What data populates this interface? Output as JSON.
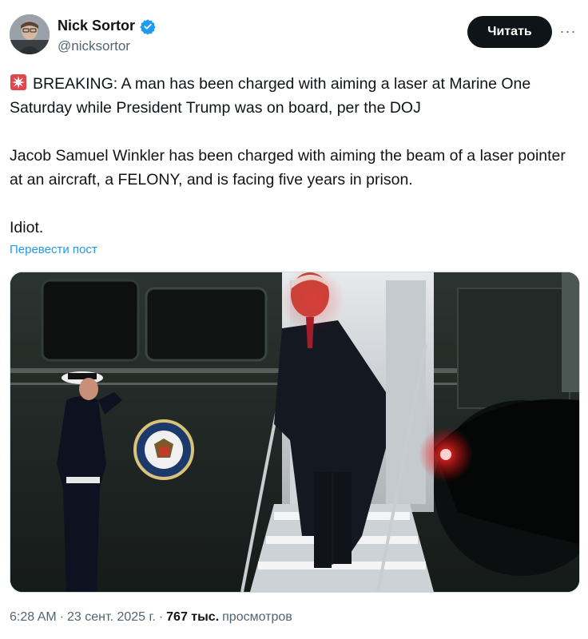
{
  "author": {
    "name": "Nick Sortor",
    "handle": "@nicksortor"
  },
  "header": {
    "read_button": "Читать",
    "more_label": "···"
  },
  "tweet": {
    "line1": "BREAKING: A man has been charged with aiming a laser at Marine One Saturday while President Trump was on board, per the DOJ",
    "line2": "Jacob Samuel Winkler has been charged with aiming the beam of a laser pointer at an aircraft, a FELONY, and is facing five years in prison.",
    "line3": "Idiot.",
    "translate_link": "Перевести пост"
  },
  "media": {
    "seal_text": "SEAL OF THE PRESIDENT OF THE UNITED STATES"
  },
  "meta": {
    "time": "6:28 AM",
    "sep1": "·",
    "date": "23 сент. 2025 г.",
    "sep2": "·",
    "views_count": "767 тыс.",
    "views_label": "просмотров"
  },
  "colors": {
    "accent": "#1d9bf0",
    "text": "#0f1419",
    "muted": "#536471"
  }
}
